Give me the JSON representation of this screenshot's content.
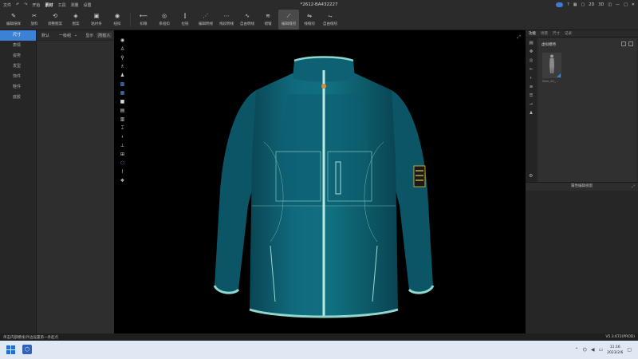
{
  "titlebar": {
    "menus": [
      "文件",
      "开始",
      "素材",
      "工具",
      "测量",
      "设置"
    ],
    "active_menu_index": 2,
    "title": "*2612-BA432227",
    "right_controls": [
      "2D",
      "3D"
    ]
  },
  "toolbar": {
    "tools": [
      {
        "label": "编辑纸样",
        "icon": "edit-pattern-icon"
      },
      {
        "label": "放料",
        "icon": "place-fabric-icon"
      },
      {
        "label": "调整图案",
        "icon": "adjust-pattern-icon"
      },
      {
        "label": "图案",
        "icon": "pattern-icon"
      },
      {
        "label": "粘衬条",
        "icon": "tape-icon"
      },
      {
        "label": "纽扣",
        "icon": "button-icon"
      },
      {
        "label": "扣眼",
        "icon": "buttonhole-icon"
      },
      {
        "label": "系纽扣",
        "icon": "fasten-button-icon"
      },
      {
        "label": "拉链",
        "icon": "zipper-icon"
      },
      {
        "label": "编辑明线",
        "icon": "edit-topstitch-icon"
      },
      {
        "label": "线段明线",
        "icon": "segment-topstitch-icon"
      },
      {
        "label": "自由明线",
        "icon": "free-topstitch-icon"
      },
      {
        "label": "褶皱",
        "icon": "fold-icon"
      },
      {
        "label": "编辑缝纫",
        "icon": "edit-sewing-icon"
      },
      {
        "label": "线缝纫",
        "icon": "line-sewing-icon"
      },
      {
        "label": "自由缝纫",
        "icon": "free-sewing-icon"
      }
    ],
    "selected_index": 13
  },
  "leftnav": {
    "items": [
      "尺寸",
      "表情",
      "姿势",
      "发型",
      "饰件",
      "鞋件",
      "底胶"
    ],
    "active_index": 0
  },
  "library": {
    "filter_default": "默认",
    "filter_level": "一级组",
    "display_label": "显示",
    "display_value": "所有人"
  },
  "right_panel": {
    "tabs": [
      "功能",
      "场景",
      "尺寸",
      "记录"
    ],
    "active_tab_index": 0,
    "section_title": "虚拟模特",
    "avatar_label": "Male_AD_..."
  },
  "properties_panel": {
    "title": "属性编辑视窗"
  },
  "statusbar": {
    "message": "单击内部模线/外边设置第一条起点",
    "version": "V5.3.672(PROD)"
  },
  "taskbar": {
    "time": "11:16",
    "date": "2023/2/6"
  },
  "colors": {
    "accent": "#3b82d6",
    "jacket": "#0e5f72",
    "trim": "#8fd8d0",
    "badge_yellow": "#e8c23a"
  }
}
